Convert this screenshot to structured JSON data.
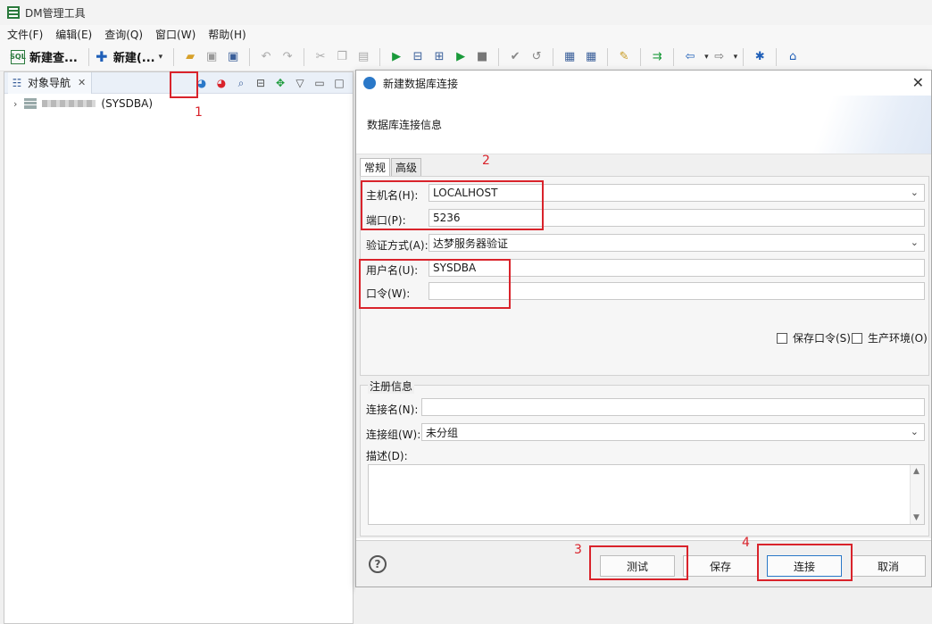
{
  "window": {
    "title": "DM管理工具"
  },
  "menu": [
    "文件(F)",
    "编辑(E)",
    "查询(Q)",
    "窗口(W)",
    "帮助(H)"
  ],
  "toolbar": {
    "new_query_label": "新建查...",
    "new_label": "新建(...",
    "caret": "▾"
  },
  "object_nav": {
    "tab_label": "对象导航",
    "tree": {
      "server_suffix": "(SYSDBA)"
    }
  },
  "annotations": [
    "1",
    "2",
    "3",
    "4"
  ],
  "dialog": {
    "title": "新建数据库连接",
    "subtitle": "数据库连接信息",
    "tabs": [
      "常规",
      "高级"
    ],
    "fields": {
      "host": {
        "label": "主机名(H):",
        "value": "LOCALHOST"
      },
      "port": {
        "label": "端口(P):",
        "value": "5236"
      },
      "auth": {
        "label": "验证方式(A):",
        "value": "达梦服务器验证"
      },
      "user": {
        "label": "用户名(U):",
        "value": "SYSDBA"
      },
      "password": {
        "label": "口令(W):",
        "value": ""
      }
    },
    "checkboxes": {
      "save_password": "保存口令(S)",
      "prod_env": "生产环境(O)"
    },
    "register": {
      "title": "注册信息",
      "conn_name_label": "连接名(N):",
      "conn_name_value": "",
      "group_label": "连接组(W):",
      "group_value": "未分组",
      "desc_label": "描述(D):"
    },
    "buttons": {
      "test": "测试",
      "save": "保存",
      "connect": "连接",
      "cancel": "取消"
    }
  },
  "colors": {
    "accent": "#2a78c8",
    "annotation": "#d9232b"
  }
}
